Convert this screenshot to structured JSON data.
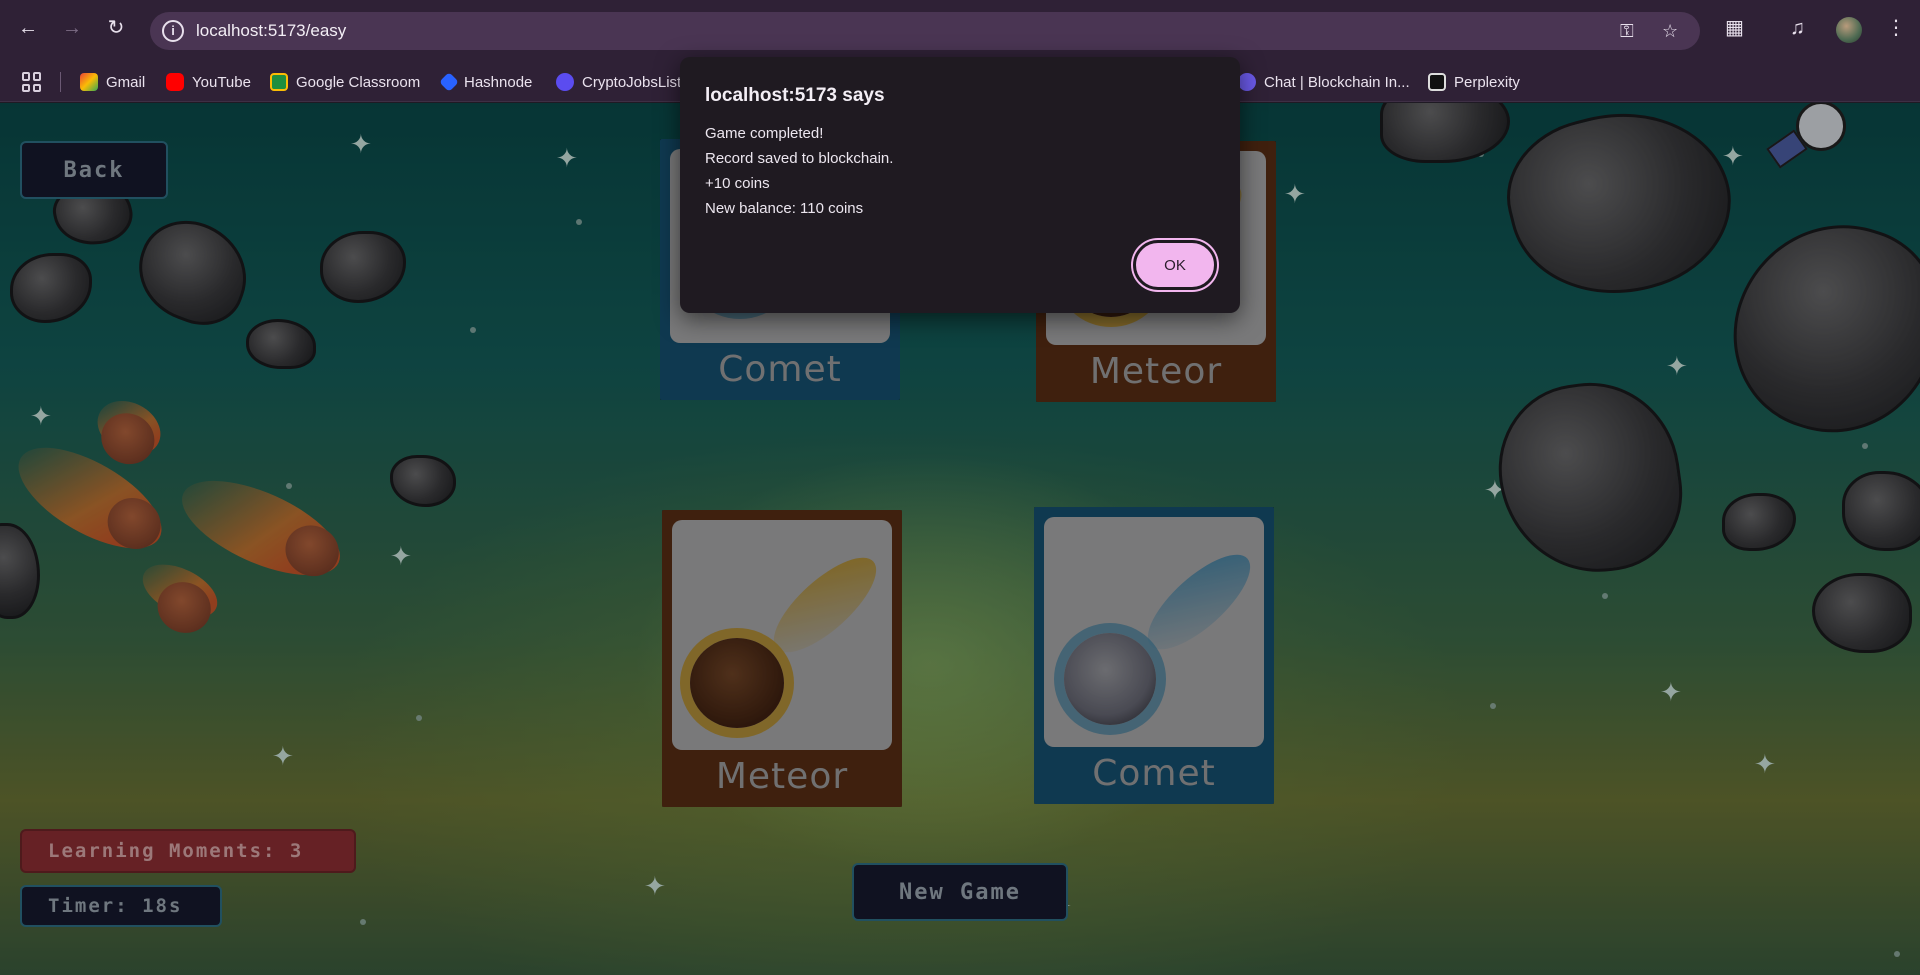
{
  "browser": {
    "url": "localhost:5173/easy",
    "bookmarks": [
      {
        "label": "Gmail",
        "color": "#ea4335"
      },
      {
        "label": "YouTube",
        "color": "#ff0000"
      },
      {
        "label": "Google Classroom",
        "color": "#1e8e3e"
      },
      {
        "label": "Hashnode",
        "color": "#2962ff"
      },
      {
        "label": "CryptoJobsList",
        "color": "#5b4cf0"
      },
      {
        "label": "Chat | Blockchain In...",
        "color": "#6b5ae8"
      },
      {
        "label": "Perplexity",
        "color": "#1a1a1a"
      }
    ]
  },
  "game": {
    "back_label": "Back",
    "new_game_label": "New Game",
    "learning_moments": "Learning Moments: 3",
    "timer": "Timer: 18s",
    "cards": [
      {
        "label": "Comet",
        "kind": "comet"
      },
      {
        "label": "Meteor",
        "kind": "meteor"
      },
      {
        "label": "Meteor",
        "kind": "meteor"
      },
      {
        "label": "Comet",
        "kind": "comet"
      }
    ]
  },
  "dialog": {
    "title": "localhost:5173 says",
    "lines": [
      "Game completed!",
      "Record saved to blockchain.",
      "+10 coins",
      "New balance: 110 coins"
    ],
    "ok_label": "OK"
  },
  "colors": {
    "comet_card": "#1e6f9a",
    "meteor_card": "#7a3f1c",
    "ok_button": "#f2b6ee",
    "learning_badge": "#8e2f34"
  }
}
